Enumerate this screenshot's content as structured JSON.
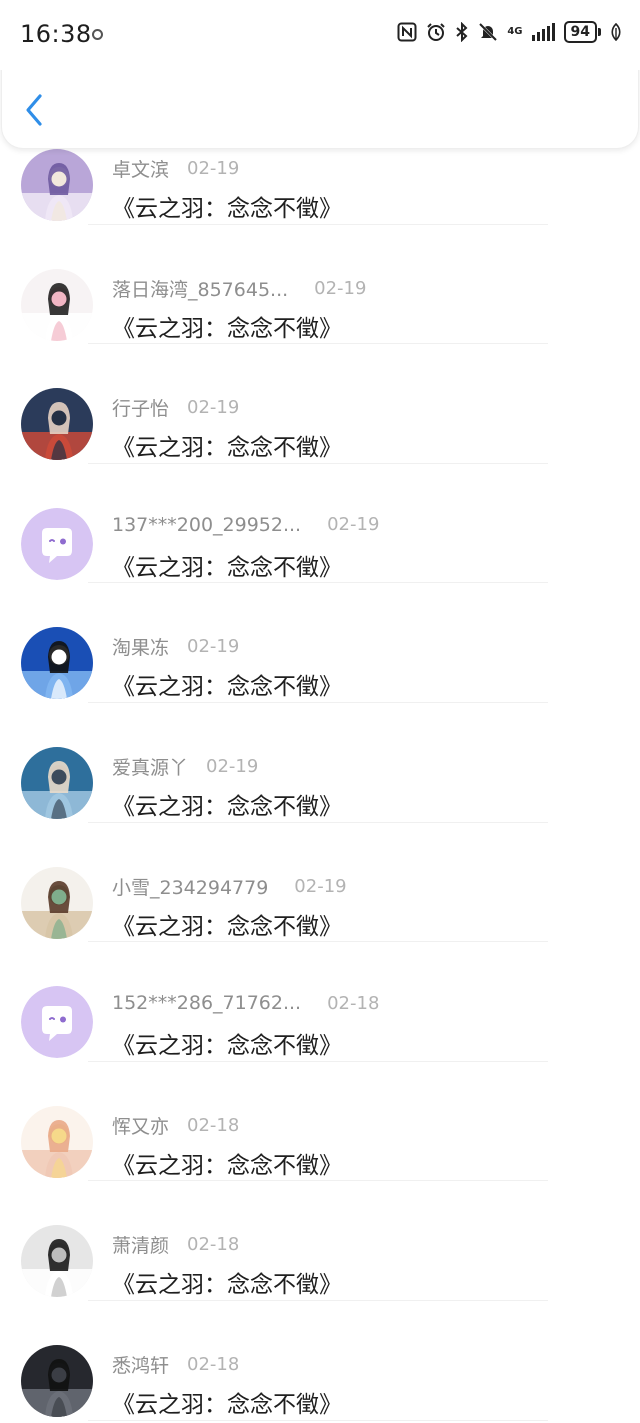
{
  "status_bar": {
    "time": "16:38",
    "network": "4G",
    "battery": "94"
  },
  "header": {
    "back_icon": "chevron-left-icon"
  },
  "colors": {
    "accent": "#2f8ee8",
    "placeholder_avatar": "#d7c5f3"
  },
  "items": [
    {
      "name": "卓文滨",
      "date": "02-19",
      "title": "《云之羽：念念不徵》",
      "avatar": "photo"
    },
    {
      "name": "落日海湾_857645...",
      "date": "02-19",
      "title": "《云之羽：念念不徵》",
      "avatar": "photo"
    },
    {
      "name": "行子怡",
      "date": "02-19",
      "title": "《云之羽：念念不徵》",
      "avatar": "photo"
    },
    {
      "name": "137***200_29952...",
      "date": "02-19",
      "title": "《云之羽：念念不徵》",
      "avatar": "default"
    },
    {
      "name": "淘果冻",
      "date": "02-19",
      "title": "《云之羽：念念不徵》",
      "avatar": "photo"
    },
    {
      "name": "爱真源丫",
      "date": "02-19",
      "title": "《云之羽：念念不徵》",
      "avatar": "photo"
    },
    {
      "name": "小雪_234294779",
      "date": "02-19",
      "title": "《云之羽：念念不徵》",
      "avatar": "photo"
    },
    {
      "name": "152***286_71762...",
      "date": "02-18",
      "title": "《云之羽：念念不徵》",
      "avatar": "default"
    },
    {
      "name": "恽又亦",
      "date": "02-18",
      "title": "《云之羽：念念不徵》",
      "avatar": "photo"
    },
    {
      "name": "萧清颜",
      "date": "02-18",
      "title": "《云之羽：念念不徵》",
      "avatar": "photo"
    },
    {
      "name": "悉鸿轩",
      "date": "02-18",
      "title": "《云之羽：念念不徵》",
      "avatar": "photo"
    }
  ]
}
